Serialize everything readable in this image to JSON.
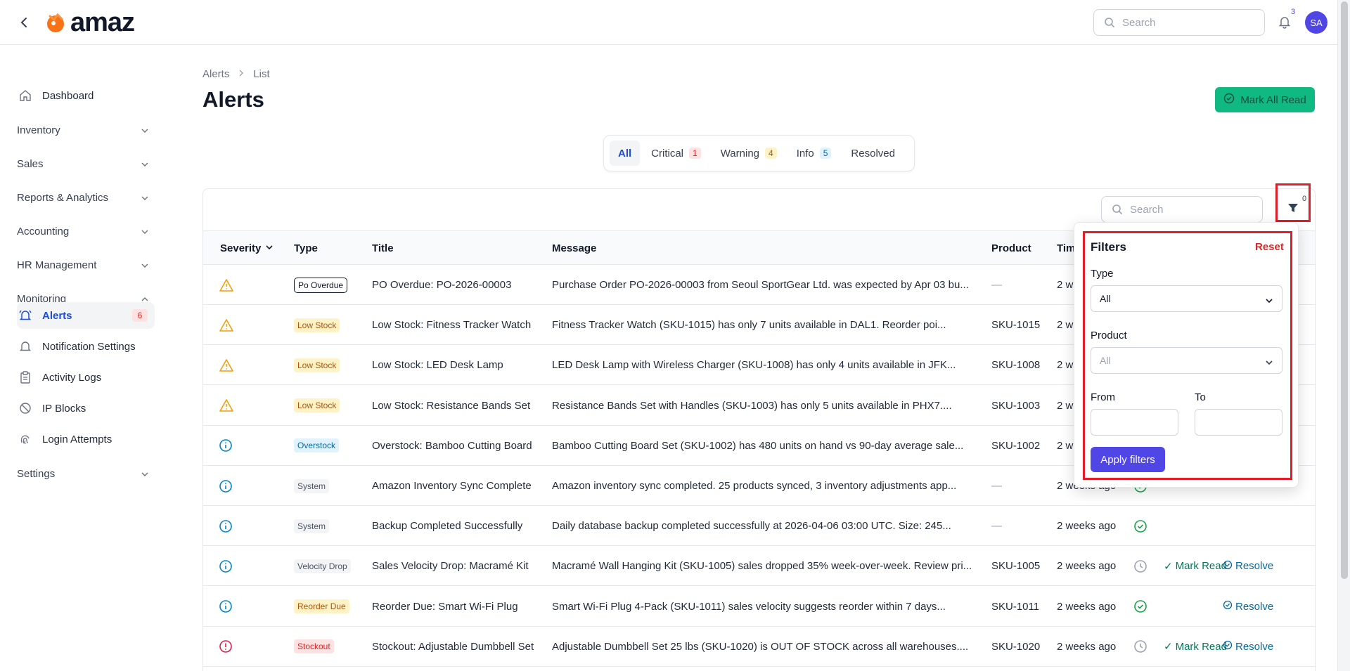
{
  "app": {
    "logo_text": "amaz"
  },
  "topbar": {
    "search_placeholder": "Search",
    "notification_count": "3",
    "avatar_initials": "SA"
  },
  "sidebar": {
    "items": [
      {
        "label": "Dashboard"
      },
      {
        "label": "Inventory"
      },
      {
        "label": "Sales"
      },
      {
        "label": "Reports & Analytics"
      },
      {
        "label": "Accounting"
      },
      {
        "label": "HR Management"
      },
      {
        "label": "Monitoring"
      },
      {
        "label": "Settings"
      }
    ],
    "monitoring_items": [
      {
        "label": "Alerts",
        "count": "6"
      },
      {
        "label": "Notification Settings"
      },
      {
        "label": "Activity Logs"
      },
      {
        "label": "IP Blocks"
      },
      {
        "label": "Login Attempts"
      }
    ]
  },
  "breadcrumb": {
    "root": "Alerts",
    "current": "List"
  },
  "page": {
    "title": "Alerts",
    "mark_all_label": "Mark All Read"
  },
  "tabs": [
    {
      "label": "All"
    },
    {
      "label": "Critical",
      "count": "1"
    },
    {
      "label": "Warning",
      "count": "4"
    },
    {
      "label": "Info",
      "count": "5"
    },
    {
      "label": "Resolved"
    }
  ],
  "table": {
    "search_placeholder": "Search",
    "filter_count": "0",
    "headers": {
      "severity": "Severity",
      "type": "Type",
      "title": "Title",
      "message": "Message",
      "product": "Product",
      "time": "Tim"
    },
    "rows": [
      {
        "severity": "warning",
        "type": "Po Overdue",
        "title": "PO Overdue: PO-2026-00003",
        "message": "Purchase Order PO-2026-00003 from Seoul SportGear Ltd. was expected by Apr 03 bu...",
        "product": "—",
        "time": "2 w"
      },
      {
        "severity": "warning",
        "type": "Low Stock",
        "title": "Low Stock: Fitness Tracker Watch",
        "message": "Fitness Tracker Watch (SKU-1015) has only 7 units available in DAL1. Reorder poi...",
        "product": "SKU-1015",
        "time": "2 w"
      },
      {
        "severity": "warning",
        "type": "Low Stock",
        "title": "Low Stock: LED Desk Lamp",
        "message": "LED Desk Lamp with Wireless Charger (SKU-1008) has only 4 units available in JFK...",
        "product": "SKU-1008",
        "time": "2 w"
      },
      {
        "severity": "warning",
        "type": "Low Stock",
        "title": "Low Stock: Resistance Bands Set",
        "message": "Resistance Bands Set with Handles (SKU-1003) has only 5 units available in PHX7....",
        "product": "SKU-1003",
        "time": "2 w"
      },
      {
        "severity": "info",
        "type": "Overstock",
        "title": "Overstock: Bamboo Cutting Board",
        "message": "Bamboo Cutting Board Set (SKU-1002) has 480 units on hand vs 90-day average sale...",
        "product": "SKU-1002",
        "time": "2 w"
      },
      {
        "severity": "info",
        "type": "System",
        "title": "Amazon Inventory Sync Complete",
        "message": "Amazon inventory sync completed. 25 products synced, 3 inventory adjustments app...",
        "product": "—",
        "time": "2 weeks ago"
      },
      {
        "severity": "info",
        "type": "System",
        "title": "Backup Completed Successfully",
        "message": "Daily database backup completed successfully at 2026-04-06 03:00 UTC. Size: 245...",
        "product": "—",
        "time": "2 weeks ago"
      },
      {
        "severity": "info",
        "type": "Velocity Drop",
        "title": "Sales Velocity Drop: Macramé Kit",
        "message": "Macramé Wall Hanging Kit (SKU-1005) sales dropped 35% week-over-week. Review pri...",
        "product": "SKU-1005",
        "time": "2 weeks ago"
      },
      {
        "severity": "info",
        "type": "Reorder Due",
        "title": "Reorder Due: Smart Wi-Fi Plug",
        "message": "Smart Wi-Fi Plug 4-Pack (SKU-1011) sales velocity suggests reorder within 7 days...",
        "product": "SKU-1011",
        "time": "2 weeks ago"
      },
      {
        "severity": "critical",
        "type": "Stockout",
        "title": "Stockout: Adjustable Dumbbell Set",
        "message": "Adjustable Dumbbell Set 25 lbs (SKU-1020) is OUT OF STOCK across all warehouses....",
        "product": "SKU-1020",
        "time": "2 weeks ago"
      }
    ],
    "actions": {
      "mark_read": "Mark Read",
      "resolve": "Resolve"
    }
  },
  "filters": {
    "title": "Filters",
    "reset_label": "Reset",
    "type_label": "Type",
    "type_value": "All",
    "product_label": "Product",
    "product_placeholder": "All",
    "from_label": "From",
    "to_label": "To",
    "apply_label": "Apply filters"
  },
  "colors": {
    "accent": "#4f46e5",
    "success": "#10b981",
    "warning": "#f59e0b",
    "info": "#0284c7",
    "critical": "#e11d48"
  }
}
